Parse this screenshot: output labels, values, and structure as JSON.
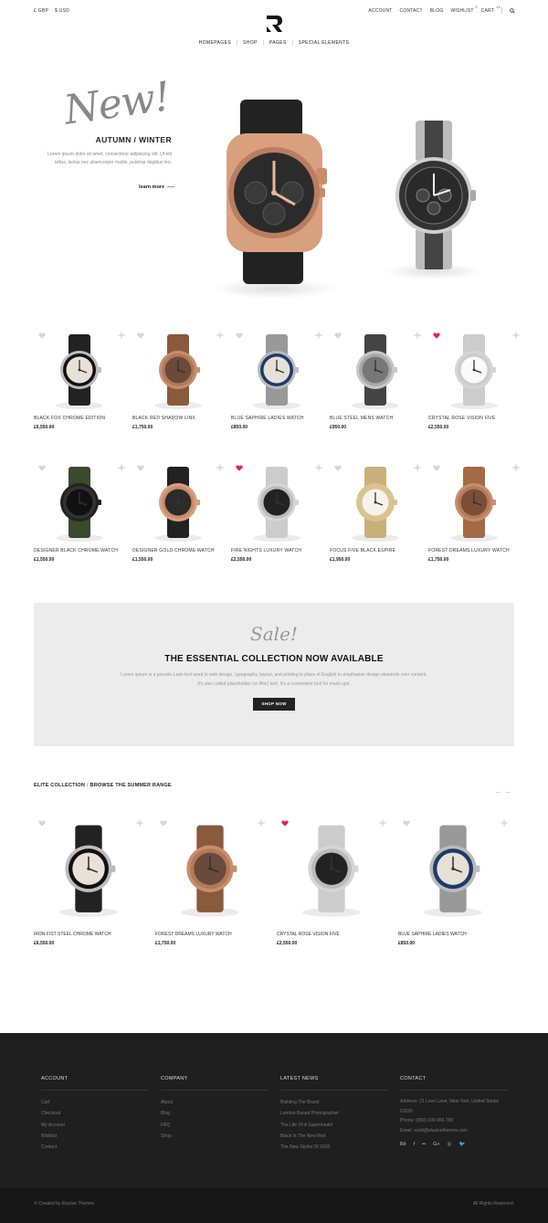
{
  "topbar": {
    "currencies": [
      "£ GBP",
      "$ USD"
    ],
    "links": {
      "account": "ACCOUNT",
      "contact": "CONTACT",
      "blog": "BLOG",
      "wishlist": "WISHLIST",
      "wishlist_count": "3",
      "cart": "CART",
      "cart_count": "16"
    }
  },
  "nav": [
    "HOMEPAGES",
    "SHOP",
    "PAGES",
    "SPECIAL ELEMENTS"
  ],
  "hero": {
    "script": "New!",
    "title": "AUTUMN / WINTER",
    "text": "Lorem ipsum dolor sit amet, consectetur adipiscing elit. Ut elit tellus, luctus nec ullamcorper mattis, pulvinar dapibus leo.",
    "link": "learn more"
  },
  "products": [
    {
      "name": "BLACK FOX CHROME EDITION",
      "price": "£6,550.00",
      "liked": false
    },
    {
      "name": "BLACK RED SHADOW LINX",
      "price": "£1,750.00",
      "liked": false
    },
    {
      "name": "BLUE SAPHIRE LADIES WATCH",
      "price": "£850.00",
      "liked": false
    },
    {
      "name": "BLUE STEEL MENS WATCH",
      "price": "£950.00",
      "liked": false
    },
    {
      "name": "CRYSTAL ROSE VISION FIVE",
      "price": "£2,550.00",
      "liked": true
    },
    {
      "name": "DESIGNER BLACK CHROME WATCH",
      "price": "£1,550.00",
      "liked": false
    },
    {
      "name": "DESIGNER GOLD CHROME WATCH",
      "price": "£1,550.00",
      "liked": false
    },
    {
      "name": "FIRE NIGHTS LUXURY WATCH",
      "price": "£2,550.00",
      "liked": true
    },
    {
      "name": "FOCUS FIVE BLACK ESPIRE",
      "price": "£1,950.00",
      "liked": false
    },
    {
      "name": "FOREST DREAMS LUXURY WATCH",
      "price": "£1,750.00",
      "liked": false
    }
  ],
  "sale": {
    "script": "Sale!",
    "title": "THE ESSENTIAL COLLECTION NOW AVAILABLE",
    "text": "Lorem ipsum is a pseudo-Latin text used in web design, typography, layout, and printing in place of English to emphasise design elements over content. It's also called placeholder (or filler) text. It's a convenient tool for mock-ups.",
    "button": "SHOP NOW"
  },
  "elite": {
    "title": "ELITE COLLECTION : BROWSE THE SUMMER RANGE",
    "arrows": "← →",
    "items": [
      {
        "name": "IRON FIST STEEL CHROME WATCH",
        "price": "£6,550.00",
        "liked": false
      },
      {
        "name": "FOREST DREAMS LUXURY WATCH",
        "price": "£1,750.00",
        "liked": false
      },
      {
        "name": "CRYSTAL ROSE VISION FIVE",
        "price": "£2,550.00",
        "liked": true
      },
      {
        "name": "BLUE SAPHIRE LADIES WATCH",
        "price": "£850.00",
        "liked": false
      }
    ]
  },
  "footer": {
    "account": {
      "title": "ACCOUNT",
      "items": [
        "Cart",
        "Checkout",
        "My Account",
        "Wishlist",
        "Contact"
      ]
    },
    "company": {
      "title": "COMPANY",
      "items": [
        "About",
        "Blog",
        "FAQ",
        "Shop"
      ]
    },
    "news": {
      "title": "LATEST NEWS",
      "items": [
        "Building The Brand",
        "London Based Photographer",
        "The Life Of A Supermodel",
        "Black Is The New Red",
        "The New Styles Of 2016"
      ]
    },
    "contact": {
      "title": "CONTACT",
      "address": "Address: 21 Love Lane, New York, United States 01620",
      "phone": "Phone: (800) 000 456 789",
      "email": "Email: scott@elusivethemes.com",
      "socials": [
        "Bē",
        "f",
        "••",
        "G+",
        "◎",
        "🐦"
      ]
    },
    "copyright": "©  Created by Elusive Themes",
    "rights": "All Rights Reserved."
  },
  "colors": {
    "accent": "#e91e63",
    "footer_bg": "#1f1f1f",
    "banner_bg": "#ececec"
  }
}
